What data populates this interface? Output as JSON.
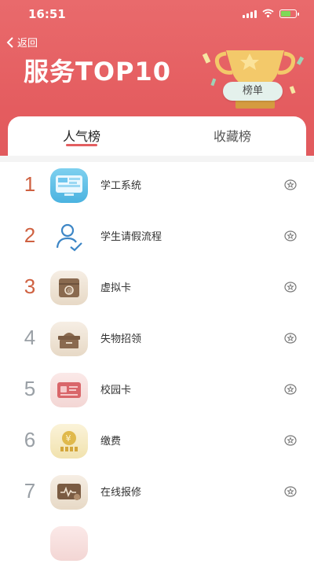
{
  "status": {
    "time": "16:51"
  },
  "nav": {
    "back_label": "返回"
  },
  "header": {
    "title": "服务TOP10",
    "badge": "榜单"
  },
  "tabs": [
    {
      "label": "人气榜",
      "active": true
    },
    {
      "label": "收藏榜",
      "active": false
    }
  ],
  "items": [
    {
      "rank": "1",
      "name": "学工系统",
      "icon": "monitor-icon"
    },
    {
      "rank": "2",
      "name": "学生请假流程",
      "icon": "user-check-icon"
    },
    {
      "rank": "3",
      "name": "虚拟卡",
      "icon": "virtual-card-icon"
    },
    {
      "rank": "4",
      "name": "失物招领",
      "icon": "lost-box-icon"
    },
    {
      "rank": "5",
      "name": "校园卡",
      "icon": "id-card-icon"
    },
    {
      "rank": "6",
      "name": "缴费",
      "icon": "yen-coin-icon"
    },
    {
      "rank": "7",
      "name": "在线报修",
      "icon": "repair-icon"
    }
  ],
  "colors": {
    "header": "#e45c5f",
    "rank_top": "#cf6141",
    "rank_rest": "#9aa0a6"
  }
}
